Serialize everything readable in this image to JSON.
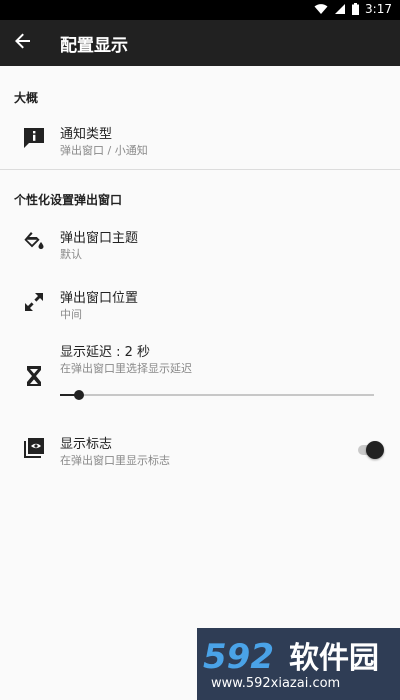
{
  "status_bar": {
    "time": "3:17",
    "icons": [
      "wifi-icon",
      "signal-icon",
      "battery-icon"
    ]
  },
  "app_bar": {
    "title": "配置显示",
    "back_icon": "arrow-left-icon"
  },
  "sections": [
    {
      "header": "大概",
      "items": [
        {
          "title": "通知类型",
          "subtitle": "弹出窗口 / 小通知",
          "icon": "notification-info-icon"
        }
      ]
    },
    {
      "header": "个性化设置弹出窗口",
      "items": [
        {
          "title": "弹出窗口主题",
          "subtitle": "默认",
          "icon": "paint-bucket-icon"
        },
        {
          "title": "弹出窗口位置",
          "subtitle": "中间",
          "icon": "move-diagonal-icon"
        },
        {
          "title": "显示延迟 : 2 秒",
          "subtitle": "在弹出窗口里选择显示延迟",
          "icon": "hourglass-icon",
          "slider_value_fraction": 0.03
        },
        {
          "title": "显示标志",
          "subtitle": "在弹出窗口里显示标志",
          "icon": "logo-badge-icon",
          "toggle_on": true
        }
      ]
    }
  ],
  "watermark": {
    "logo_text": "592软件园",
    "url": "www.592xiazai.com",
    "logo_colors": {
      "digits": "#4aa3e8",
      "cjk": "#ffffff",
      "background": "#2f3d55"
    }
  },
  "colors": {
    "app_bar": "#212121",
    "status_bar": "#000000",
    "background": "#fafafa",
    "primary_text": "#222222",
    "secondary_text": "#8a8a8a"
  }
}
